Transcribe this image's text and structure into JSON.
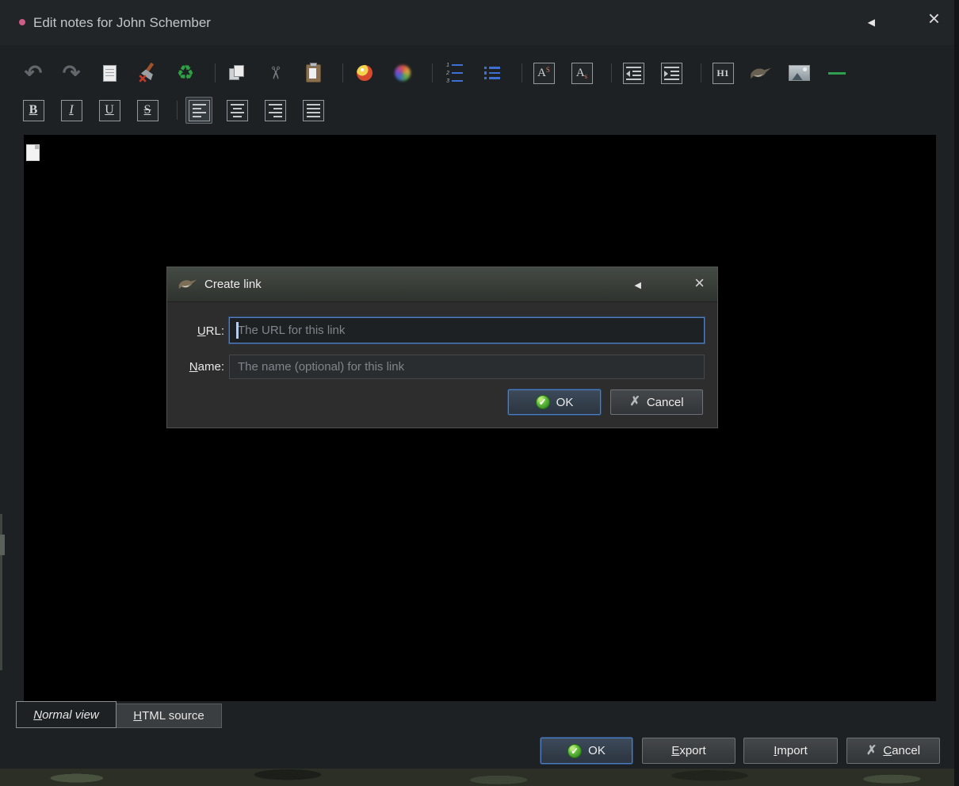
{
  "window": {
    "title": "Edit notes for John Schember"
  },
  "icons": {
    "back": "◀",
    "close": "×",
    "check": "✓",
    "cross": "✗",
    "undo": "↶",
    "redo": "↷",
    "recycle": "♻",
    "cut": "✂",
    "superscript_base": "A",
    "superscript_mark": "S",
    "subscript_base": "A",
    "subscript_mark": "s",
    "heading1": "H1",
    "bold": "B",
    "italic": "I",
    "underline": "U",
    "strikethrough": "S"
  },
  "dialog": {
    "title": "Create link",
    "url_label": {
      "u": "U",
      "rest": "RL:"
    },
    "url_placeholder": "The URL for this link",
    "name_label": {
      "u": "N",
      "rest": "ame:"
    },
    "name_placeholder": "The name (optional) for this link",
    "ok_label": "OK",
    "cancel_label": "Cancel"
  },
  "view_tabs": {
    "normal": {
      "u": "N",
      "rest": "ormal view"
    },
    "html": {
      "u": "H",
      "rest": "TML source"
    }
  },
  "footer": {
    "ok_label": "OK",
    "export": {
      "u": "E",
      "rest": "xport"
    },
    "import": {
      "u": "I",
      "rest": "mport"
    },
    "cancel": {
      "u": "C",
      "rest": "ancel"
    }
  },
  "colors": {
    "accent_blue": "#4f7fc0",
    "check_green": "#2f8a1f",
    "list_blue": "#3e6fd2",
    "hr_green": "#2f9e4f",
    "title_dot_pink": "#cf5c86"
  }
}
